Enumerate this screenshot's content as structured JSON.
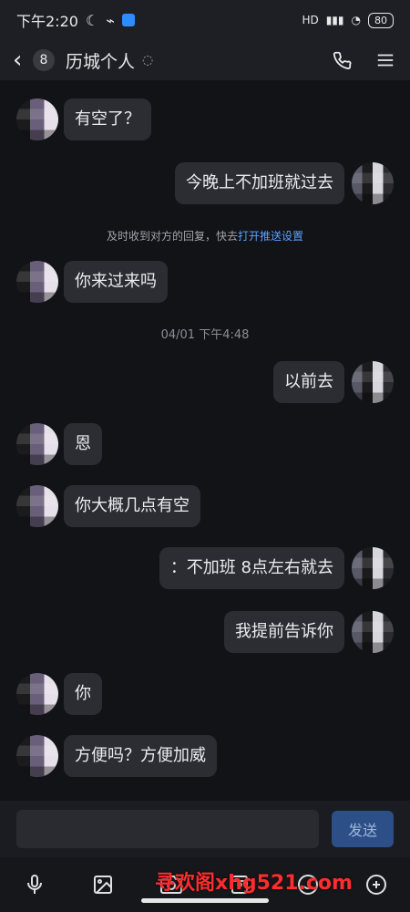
{
  "status_bar": {
    "time": "下午2:20",
    "network": "HD",
    "battery": "80"
  },
  "header": {
    "unread_count": "8",
    "title": "历城个人"
  },
  "messages": [
    {
      "side": "left",
      "text": "有空了？"
    },
    {
      "side": "right",
      "text": "今晚上不加班就过去"
    },
    {
      "side": "system",
      "text_prefix": "及时收到对方的回复，快去",
      "link_text": "打开",
      "text_suffix": "推送设置"
    },
    {
      "side": "left",
      "text": "你来过来吗"
    },
    {
      "side": "timestamp",
      "text": "04/01 下午4:48"
    },
    {
      "side": "right",
      "text": "以前去"
    },
    {
      "side": "left",
      "text": "恩"
    },
    {
      "side": "left",
      "text": "你大概几点有空"
    },
    {
      "side": "right",
      "text": "：不加班  8点左右就去"
    },
    {
      "side": "right",
      "text": "我提前告诉你"
    },
    {
      "side": "left",
      "text": "你"
    },
    {
      "side": "left",
      "text": "方便吗？方便加威"
    }
  ],
  "input_bar": {
    "send_label": "发送"
  },
  "watermark": "寻欢阁xhg521.com",
  "icons": {
    "mic": "mic-icon",
    "image": "image-icon",
    "camera": "camera-icon",
    "redpacket": "redpacket-icon",
    "emoji": "emoji-icon",
    "plus": "plus-icon"
  }
}
